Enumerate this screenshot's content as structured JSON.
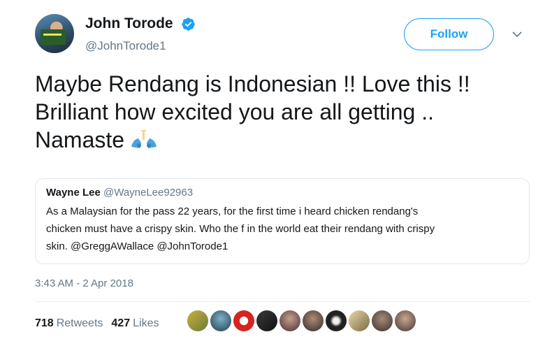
{
  "author": {
    "display_name": "John Torode",
    "handle": "@JohnTorode1",
    "verified_icon": "verified-badge-icon"
  },
  "follow_label": "Follow",
  "tweet": {
    "lines": [
      "Maybe Rendang is Indonesian !!   Love this !!",
      "Brilliant how excited you are all getting ..",
      "Namaste"
    ],
    "emoji_icon": "folded-hands-icon"
  },
  "quoted": {
    "name": "Wayne Lee",
    "handle": "@WayneLee92963",
    "lines": [
      "As a Malaysian for the pass 22 years, for the first time i heard chicken rendang's",
      "chicken must have a crispy skin. Who the f in the world eat their rendang with crispy",
      "skin. @GreggAWallace @JohnTorode1"
    ]
  },
  "timestamp": "3:43 AM - 2 Apr 2018",
  "stats": {
    "retweets_count": "718",
    "retweets_label": "Retweets",
    "likes_count": "427",
    "likes_label": "Likes"
  },
  "colors": {
    "accent": "#1da1f2",
    "secondary_text": "#657786",
    "border": "#e1e8ed"
  },
  "liker_avatars": [
    "liker-avatar-1",
    "liker-avatar-2",
    "liker-avatar-3",
    "liker-avatar-4",
    "liker-avatar-5",
    "liker-avatar-6",
    "liker-avatar-7",
    "liker-avatar-8",
    "liker-avatar-9",
    "liker-avatar-10"
  ]
}
